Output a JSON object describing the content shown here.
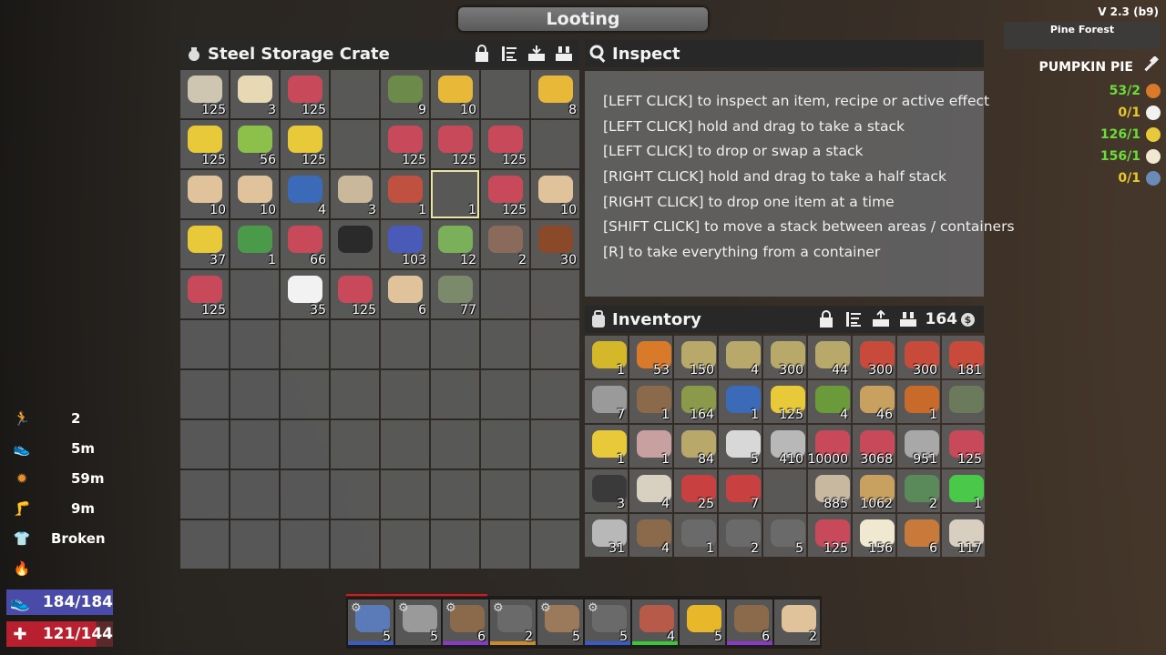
{
  "window_title": "Looting",
  "version": "V 2.3 (b9)",
  "biome": "Pine Forest",
  "container": {
    "title": "Steel Storage Crate",
    "slots": [
      {
        "count": "125",
        "color": "#cfc6b2"
      },
      {
        "count": "3",
        "color": "#e6d9b4"
      },
      {
        "count": "125",
        "color": "#c84a5a"
      },
      {
        "count": "",
        "color": ""
      },
      {
        "count": "9",
        "color": "#6c8a4a"
      },
      {
        "count": "10",
        "color": "#e8b838"
      },
      {
        "count": "",
        "color": ""
      },
      {
        "count": "8",
        "color": "#e8b838"
      },
      {
        "count": "125",
        "color": "#e8c93a"
      },
      {
        "count": "56",
        "color": "#8cc04a"
      },
      {
        "count": "125",
        "color": "#e8c93a"
      },
      {
        "count": "",
        "color": ""
      },
      {
        "count": "125",
        "color": "#c84a5a"
      },
      {
        "count": "125",
        "color": "#c84a5a"
      },
      {
        "count": "125",
        "color": "#c84a5a"
      },
      {
        "count": "",
        "color": ""
      },
      {
        "count": "10",
        "color": "#e0c39a"
      },
      {
        "count": "10",
        "color": "#e0c39a"
      },
      {
        "count": "4",
        "color": "#3a6ab8"
      },
      {
        "count": "3",
        "color": "#c9b89a"
      },
      {
        "count": "1",
        "color": "#c05040"
      },
      {
        "count": "1",
        "color": ""
      },
      {
        "count": "125",
        "color": "#c84a5a"
      },
      {
        "count": "10",
        "color": "#e0c39a"
      },
      {
        "count": "37",
        "color": "#e8c93a"
      },
      {
        "count": "1",
        "color": "#4a9a4a"
      },
      {
        "count": "66",
        "color": "#c84a5a"
      },
      {
        "count": "",
        "color": "#2a2a2a"
      },
      {
        "count": "103",
        "color": "#4a5ab8"
      },
      {
        "count": "12",
        "color": "#7ab05a"
      },
      {
        "count": "2",
        "color": "#8a6a5a"
      },
      {
        "count": "30",
        "color": "#8a4a2a"
      },
      {
        "count": "125",
        "color": "#c84a5a"
      },
      {
        "count": "",
        "color": ""
      },
      {
        "count": "35",
        "color": "#f2f2f2"
      },
      {
        "count": "125",
        "color": "#c84a5a"
      },
      {
        "count": "6",
        "color": "#e0c39a"
      },
      {
        "count": "77",
        "color": "#7a8a6a"
      },
      {
        "count": "",
        "color": ""
      },
      {
        "count": "",
        "color": ""
      }
    ],
    "empty_rows": 5,
    "selected_index": 21
  },
  "inspect": {
    "title": "Inspect",
    "lines": [
      "[LEFT CLICK] to inspect an item, recipe or active effect",
      "[LEFT CLICK] hold and drag to take a stack",
      "[LEFT CLICK] to drop or swap a stack",
      "[RIGHT CLICK] hold and drag to take a half stack",
      "[RIGHT CLICK] to drop one item at a time",
      "[SHIFT CLICK] to move a stack between areas / containers",
      "[R] to take everything from a container"
    ]
  },
  "inventory": {
    "title": "Inventory",
    "money": "164",
    "slots": [
      {
        "count": "1",
        "color": "#d4b82a"
      },
      {
        "count": "53",
        "color": "#d87a2a"
      },
      {
        "count": "150",
        "color": "#b8a86a"
      },
      {
        "count": "4",
        "color": "#b8a86a"
      },
      {
        "count": "300",
        "color": "#b8a86a"
      },
      {
        "count": "44",
        "color": "#b8a86a"
      },
      {
        "count": "300",
        "color": "#c84a3a"
      },
      {
        "count": "300",
        "color": "#c84a3a"
      },
      {
        "count": "181",
        "color": "#c84a3a"
      },
      {
        "count": "7",
        "color": "#9a9a9a"
      },
      {
        "count": "1",
        "color": "#8a6a4a"
      },
      {
        "count": "164",
        "color": "#8a9a4a"
      },
      {
        "count": "1",
        "color": "#3a6ab8"
      },
      {
        "count": "125",
        "color": "#e8c93a"
      },
      {
        "count": "4",
        "color": "#6a9a3a"
      },
      {
        "count": "46",
        "color": "#c8a060"
      },
      {
        "count": "1",
        "color": "#c86a2a"
      },
      {
        "count": "",
        "color": "#6a7a5a"
      },
      {
        "count": "1",
        "color": "#e8c93a"
      },
      {
        "count": "1",
        "color": "#c8a0a0"
      },
      {
        "count": "84",
        "color": "#b8a86a"
      },
      {
        "count": "5",
        "color": "#d8d8d8"
      },
      {
        "count": "410",
        "color": "#b8b8b8"
      },
      {
        "count": "10000",
        "color": "#c84a5a"
      },
      {
        "count": "3068",
        "color": "#c84a5a"
      },
      {
        "count": "951",
        "color": "#a8a8a8"
      },
      {
        "count": "125",
        "color": "#c84a5a"
      },
      {
        "count": "3",
        "color": "#3a3a3a"
      },
      {
        "count": "4",
        "color": "#d8d0c0"
      },
      {
        "count": "25",
        "color": "#c84040"
      },
      {
        "count": "7",
        "color": "#c84040"
      },
      {
        "count": "",
        "color": ""
      },
      {
        "count": "885",
        "color": "#c8b8a0"
      },
      {
        "count": "1062",
        "color": "#c8a060"
      },
      {
        "count": "2",
        "color": "#5a8a5a"
      },
      {
        "count": "1",
        "color": "#4ac84a"
      },
      {
        "count": "31",
        "color": "#b8b8b8"
      },
      {
        "count": "4",
        "color": "#8a6a4a"
      },
      {
        "count": "1",
        "color": "#6a6a6a"
      },
      {
        "count": "2",
        "color": "#6a6a6a"
      },
      {
        "count": "5",
        "color": "#6a6a6a"
      },
      {
        "count": "125",
        "color": "#c84a5a"
      },
      {
        "count": "156",
        "color": "#f0e8d0"
      },
      {
        "count": "6",
        "color": "#c87a3a"
      },
      {
        "count": "117",
        "color": "#d8cfc0"
      }
    ]
  },
  "recipe": {
    "title": "PUMPKIN PIE",
    "ingredients": [
      {
        "text": "53/2",
        "color": "#6bdc3a",
        "icon": "#d87a2a"
      },
      {
        "text": "0/1",
        "color": "#e8c82a",
        "icon": "#f2f2f2"
      },
      {
        "text": "126/1",
        "color": "#6bdc3a",
        "icon": "#e8c93a"
      },
      {
        "text": "156/1",
        "color": "#6bdc3a",
        "icon": "#f0e8d0"
      },
      {
        "text": "0/1",
        "color": "#e8c82a",
        "icon": "#6a8ab8"
      }
    ]
  },
  "stats": [
    {
      "icon": "running-icon",
      "value": "2"
    },
    {
      "icon": "sprint-icon",
      "value": "5m"
    },
    {
      "icon": "stamina-food-icon",
      "value": "59m"
    },
    {
      "icon": "leg-icon",
      "value": "9m"
    },
    {
      "icon": "armor-icon",
      "value": "Broken"
    },
    {
      "icon": "fire-icon",
      "value": ""
    }
  ],
  "stamina": "184/184",
  "health": "121/144",
  "toolbelt": [
    {
      "count": "5",
      "color": "#5a7ab8",
      "bar": "#3a5ac8",
      "gear": true
    },
    {
      "count": "5",
      "color": "#9a9a9a",
      "bar": "",
      "gear": true
    },
    {
      "count": "6",
      "color": "#8a6a4a",
      "bar": "#8a3ac8",
      "gear": true
    },
    {
      "count": "2",
      "color": "#6a6a6a",
      "bar": "#c88a2a",
      "gear": true
    },
    {
      "count": "5",
      "color": "#9a7a5a",
      "bar": "",
      "gear": true
    },
    {
      "count": "5",
      "color": "#6a6a6a",
      "bar": "#3a5ac8",
      "gear": true
    },
    {
      "count": "4",
      "color": "#b85a4a",
      "bar": "#3ac83a",
      "gear": false
    },
    {
      "count": "5",
      "color": "#e8b82a",
      "bar": "",
      "gear": false
    },
    {
      "count": "6",
      "color": "#8a6a4a",
      "bar": "#8a3ac8",
      "gear": false
    },
    {
      "count": "2",
      "color": "#e0c39a",
      "bar": "",
      "gear": false
    }
  ]
}
